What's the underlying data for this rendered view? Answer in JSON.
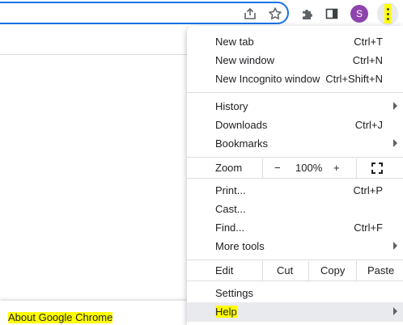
{
  "toolbar": {
    "share_icon": "share-icon",
    "star_icon": "star-icon",
    "extensions_icon": "puzzle-icon",
    "sidepanel_icon": "side-panel-icon",
    "avatar_letter": "S",
    "avatar_color": "#8e44ad",
    "menu_icon": "kebab-menu-icon"
  },
  "menu": {
    "new_tab": {
      "label": "New tab",
      "shortcut": "Ctrl+T"
    },
    "new_window": {
      "label": "New window",
      "shortcut": "Ctrl+N"
    },
    "new_incognito": {
      "label": "New Incognito window",
      "shortcut": "Ctrl+Shift+N"
    },
    "history": {
      "label": "History"
    },
    "downloads": {
      "label": "Downloads",
      "shortcut": "Ctrl+J"
    },
    "bookmarks": {
      "label": "Bookmarks"
    },
    "zoom": {
      "label": "Zoom",
      "minus": "−",
      "value": "100%",
      "plus": "+"
    },
    "print": {
      "label": "Print...",
      "shortcut": "Ctrl+P"
    },
    "cast": {
      "label": "Cast..."
    },
    "find": {
      "label": "Find...",
      "shortcut": "Ctrl+F"
    },
    "more_tools": {
      "label": "More tools"
    },
    "edit": {
      "label": "Edit",
      "cut": "Cut",
      "copy": "Copy",
      "paste": "Paste"
    },
    "settings": {
      "label": "Settings"
    },
    "help": {
      "label": "Help"
    }
  },
  "submenu": {
    "about": "About Google Chrome"
  },
  "colors": {
    "accent": "#1a73e8",
    "highlight": "#ffff00",
    "hover_row": "#e8eaed"
  }
}
